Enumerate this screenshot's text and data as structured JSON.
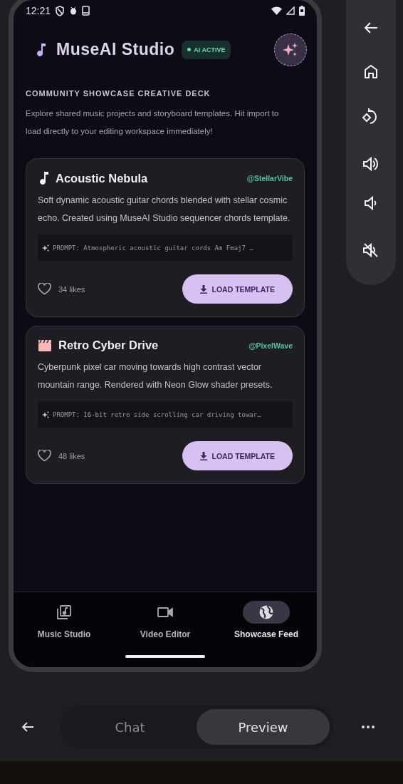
{
  "status_bar": {
    "time": "12:21"
  },
  "header": {
    "title": "MuseAI Studio",
    "badge": "AI ACTIVE"
  },
  "section": {
    "title": "COMMUNITY SHOWCASE CREATIVE DECK",
    "description": "Explore shared music projects and storyboard templates. Hit import to load directly to your editing workspace immediately!"
  },
  "cards": [
    {
      "kind": "music",
      "title": "Acoustic Nebula",
      "author": "@StellarVibe",
      "description": "Soft dynamic acoustic guitar chords blended with stellar cosmic echo. Created using MuseAI Studio sequencer chords template.",
      "prompt": "PROMPT: Atmospheric acoustic guitar cords Am  Fmaj7 …",
      "likes": "34 likes",
      "button": "LOAD TEMPLATE"
    },
    {
      "kind": "video",
      "title": "Retro Cyber Drive",
      "author": "@PixelWave",
      "description": "Cyberpunk pixel car moving towards high contrast vector mountain range. Rendered with Neon Glow shader presets.",
      "prompt": "PROMPT: 16-bit retro side scrolling car driving towar…",
      "likes": "48 likes",
      "button": "LOAD TEMPLATE"
    }
  ],
  "bottom_nav": [
    {
      "kind": "music",
      "label": "Music Studio",
      "selected": false
    },
    {
      "kind": "video",
      "label": "Video Editor",
      "selected": false
    },
    {
      "kind": "globe",
      "label": "Showcase Feed",
      "selected": true
    }
  ],
  "host_tabs": [
    {
      "label": "Chat",
      "selected": false
    },
    {
      "label": "Preview",
      "selected": true
    }
  ]
}
